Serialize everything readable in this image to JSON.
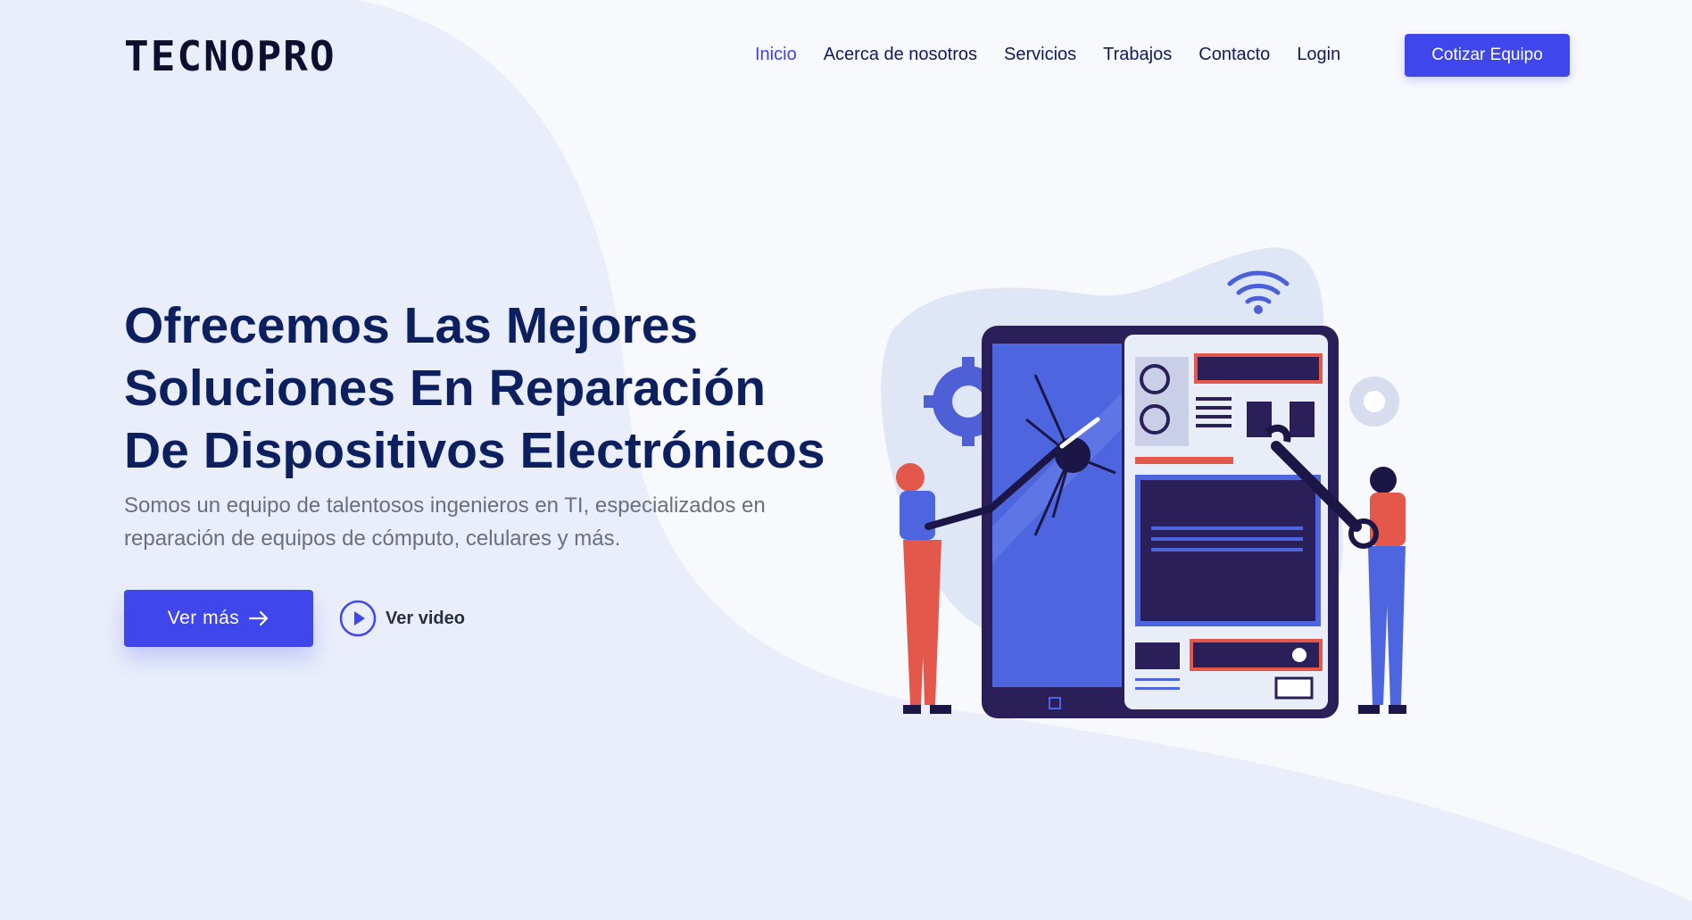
{
  "brand": {
    "logo_text": "TECNOPRO"
  },
  "nav": {
    "items": [
      {
        "label": "Inicio",
        "active": true
      },
      {
        "label": "Acerca de nosotros",
        "active": false
      },
      {
        "label": "Servicios",
        "active": false
      },
      {
        "label": "Trabajos",
        "active": false
      },
      {
        "label": "Contacto",
        "active": false
      },
      {
        "label": "Login",
        "active": false
      }
    ],
    "cta_label": "Cotizar Equipo"
  },
  "hero": {
    "title_lines": [
      "Ofrecemos Las Mejores",
      "Soluciones En Reparación",
      "De Dispositivos Electrónicos"
    ],
    "subtitle": "Somos un equipo de talentosos ingenieros en TI, especializados en reparación de equipos de cómputo, celulares y más.",
    "primary_button": "Ver más",
    "video_link": "Ver video"
  },
  "icons": {
    "arrow": "arrow-right-icon",
    "play": "play-circle-icon"
  },
  "colors": {
    "accent": "#3f47ec",
    "heading": "#0c1f5e",
    "nav_text": "#0f1b5c",
    "nav_active": "#3b43e6",
    "background": "#eef2fb"
  }
}
